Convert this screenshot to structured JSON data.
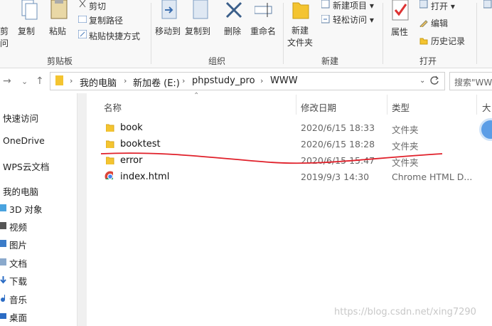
{
  "ribbon": {
    "clipboard": {
      "pin_label_1": "剪",
      "pin_label_2": "问",
      "copy": "复制",
      "paste": "粘贴",
      "cut": "剪切",
      "copy_path": "复制路径",
      "paste_shortcut": "粘贴快捷方式",
      "group": "剪贴板"
    },
    "organize": {
      "move_to": "移动到",
      "copy_to": "复制到",
      "delete": "删除",
      "rename": "重命名",
      "group": "组织"
    },
    "new": {
      "new_folder_1": "新建",
      "new_folder_2": "文件夹",
      "new_item": "新建项目 ▾",
      "easy_access": "轻松访问 ▾",
      "group": "新建"
    },
    "open": {
      "properties": "属性",
      "open": "打开 ▾",
      "edit": "编辑",
      "history": "历史记录",
      "group": "打开"
    }
  },
  "address": {
    "crumbs": [
      "我的电脑",
      "新加卷 (E:)",
      "phpstudy_pro",
      "WWW"
    ],
    "search_placeholder": "搜索\"WWW\""
  },
  "sidebar": {
    "items": [
      "快速访问",
      "OneDrive",
      "WPS云文档",
      "我的电脑",
      "3D 对象",
      "视频",
      "图片",
      "文档",
      "下载",
      "音乐",
      "桌面"
    ]
  },
  "columns": {
    "name": "名称",
    "date": "修改日期",
    "type": "类型",
    "size": "大"
  },
  "files": [
    {
      "name": "book",
      "date": "2020/6/15 18:33",
      "type": "文件夹",
      "icon": "folder-icon"
    },
    {
      "name": "booktest",
      "date": "2020/6/15 18:28",
      "type": "文件夹",
      "icon": "folder-icon"
    },
    {
      "name": "error",
      "date": "2020/6/15 15:47",
      "type": "文件夹",
      "icon": "folder-icon"
    },
    {
      "name": "index.html",
      "date": "2019/9/3 14:30",
      "type": "Chrome HTML D...",
      "icon": "chrome-icon"
    }
  ],
  "watermark": "https://blog.csdn.net/xing7290",
  "colors": {
    "annotation": "#e0202a",
    "folder": "#f4c430",
    "accent": "#0a74da"
  }
}
